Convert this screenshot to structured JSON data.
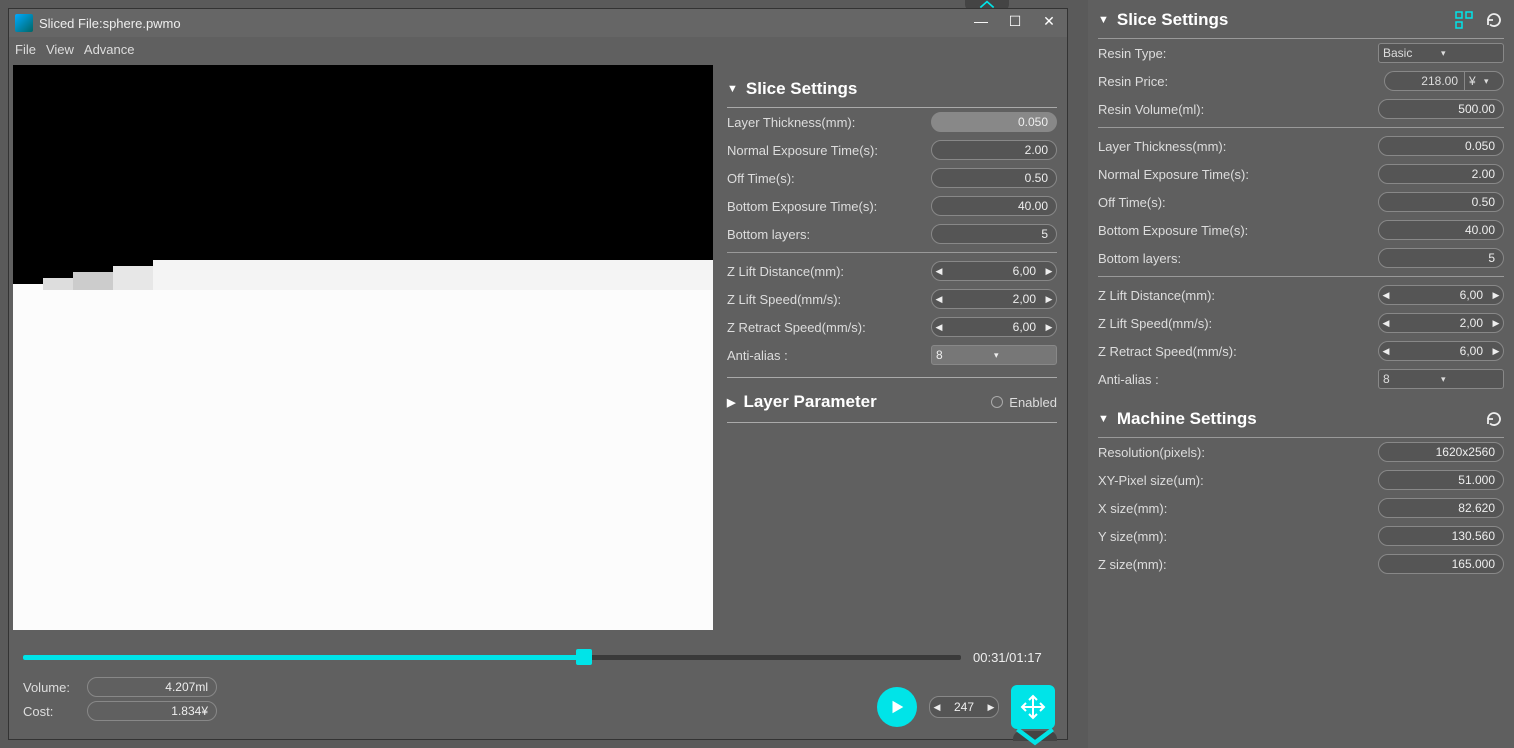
{
  "window": {
    "title": "Sliced File:sphere.pwmo",
    "menu": {
      "file": "File",
      "view": "View",
      "advance": "Advance"
    }
  },
  "slice_settings_left": {
    "header": "Slice Settings",
    "layer_thickness": {
      "label": "Layer Thickness(mm):",
      "value": "0.050"
    },
    "normal_exposure": {
      "label": "Normal Exposure Time(s):",
      "value": "2.00"
    },
    "off_time": {
      "label": "Off Time(s):",
      "value": "0.50"
    },
    "bottom_exposure": {
      "label": "Bottom Exposure Time(s):",
      "value": "40.00"
    },
    "bottom_layers": {
      "label": "Bottom layers:",
      "value": "5"
    },
    "z_lift_dist": {
      "label": "Z Lift Distance(mm):",
      "value": "6,00"
    },
    "z_lift_speed": {
      "label": "Z Lift Speed(mm/s):",
      "value": "2,00"
    },
    "z_retract": {
      "label": "Z Retract Speed(mm/s):",
      "value": "6,00"
    },
    "anti_alias": {
      "label": "Anti-alias :",
      "value": "8"
    }
  },
  "layer_param": {
    "header": "Layer Parameter",
    "enabled_label": "Enabled"
  },
  "timeline": {
    "time": "00:31/01:17",
    "frame": "247"
  },
  "info": {
    "volume_label": "Volume:",
    "volume_value": "4.207ml",
    "cost_label": "Cost:",
    "cost_value": "1.834¥"
  },
  "right": {
    "slice_header": "Slice Settings",
    "resin_type": {
      "label": "Resin Type:",
      "value": "Basic"
    },
    "resin_price": {
      "label": "Resin Price:",
      "value": "218.00",
      "currency": "¥"
    },
    "resin_volume": {
      "label": "Resin Volume(ml):",
      "value": "500.00"
    },
    "layer_thickness": {
      "label": "Layer Thickness(mm):",
      "value": "0.050"
    },
    "normal_exposure": {
      "label": "Normal Exposure Time(s):",
      "value": "2.00"
    },
    "off_time": {
      "label": "Off Time(s):",
      "value": "0.50"
    },
    "bottom_exposure": {
      "label": "Bottom Exposure Time(s):",
      "value": "40.00"
    },
    "bottom_layers": {
      "label": "Bottom layers:",
      "value": "5"
    },
    "z_lift_dist": {
      "label": "Z Lift Distance(mm):",
      "value": "6,00"
    },
    "z_lift_speed": {
      "label": "Z Lift Speed(mm/s):",
      "value": "2,00"
    },
    "z_retract": {
      "label": "Z Retract Speed(mm/s):",
      "value": "6,00"
    },
    "anti_alias": {
      "label": "Anti-alias :",
      "value": "8"
    },
    "machine_header": "Machine Settings",
    "resolution": {
      "label": "Resolution(pixels):",
      "value": "1620x2560"
    },
    "xy_pixel": {
      "label": "XY-Pixel size(um):",
      "value": "51.000"
    },
    "x_size": {
      "label": "X size(mm):",
      "value": "82.620"
    },
    "y_size": {
      "label": "Y size(mm):",
      "value": "130.560"
    },
    "z_size": {
      "label": "Z size(mm):",
      "value": "165.000"
    }
  }
}
